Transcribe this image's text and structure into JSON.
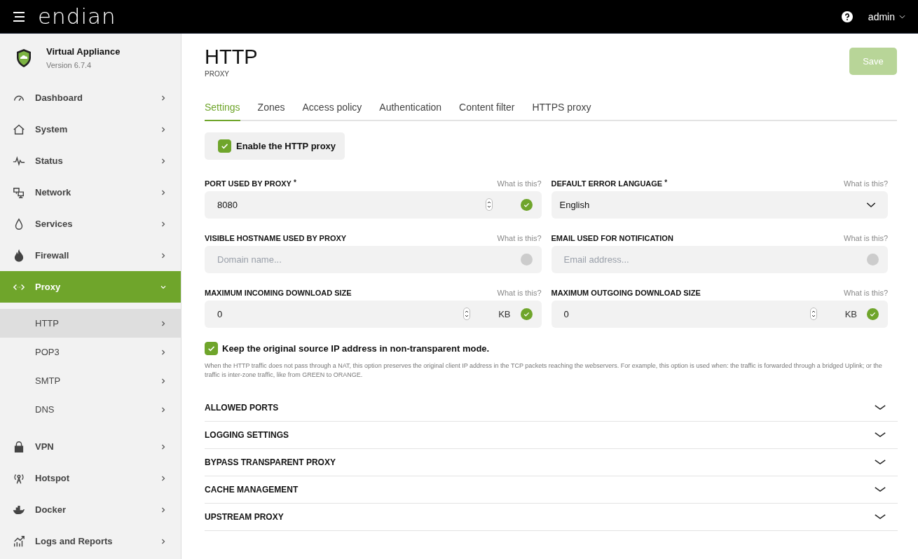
{
  "topbar": {
    "logo": "endian",
    "user": "admin"
  },
  "sidebar": {
    "product": "Virtual Appliance",
    "version": "Version 6.7.4",
    "items": [
      {
        "label": "Dashboard",
        "expanded": false,
        "selected": false
      },
      {
        "label": "System",
        "expanded": false,
        "selected": false
      },
      {
        "label": "Status",
        "expanded": false,
        "selected": false
      },
      {
        "label": "Network",
        "expanded": false,
        "selected": false
      },
      {
        "label": "Services",
        "expanded": false,
        "selected": false
      },
      {
        "label": "Firewall",
        "expanded": false,
        "selected": false
      },
      {
        "label": "Proxy",
        "expanded": true,
        "selected": true,
        "children": [
          {
            "label": "HTTP",
            "selected": true
          },
          {
            "label": "POP3",
            "selected": false
          },
          {
            "label": "SMTP",
            "selected": false
          },
          {
            "label": "DNS",
            "selected": false
          }
        ]
      },
      {
        "label": "VPN",
        "expanded": false,
        "selected": false
      },
      {
        "label": "Hotspot",
        "expanded": false,
        "selected": false
      },
      {
        "label": "Docker",
        "expanded": false,
        "selected": false
      },
      {
        "label": "Logs and Reports",
        "expanded": false,
        "selected": false
      }
    ]
  },
  "page": {
    "title": "HTTP",
    "subtitle": "PROXY",
    "save": {
      "label": "Save",
      "disabled": true
    }
  },
  "tabs": [
    {
      "label": "Settings",
      "selected": true
    },
    {
      "label": "Zones",
      "selected": false
    },
    {
      "label": "Access policy",
      "selected": false
    },
    {
      "label": "Authentication",
      "selected": false
    },
    {
      "label": "Content filter",
      "selected": false
    },
    {
      "label": "HTTPS proxy",
      "selected": false
    }
  ],
  "enable": {
    "label": "Enable the HTTP proxy",
    "checked": true
  },
  "fields": [
    {
      "kind": "number",
      "label": "PORT USED BY PROXY",
      "required_mark": "*",
      "help": "What is this?",
      "value": "8080",
      "valid": true
    },
    {
      "kind": "select",
      "label": "DEFAULT ERROR LANGUAGE",
      "required_mark": "*",
      "help": "What is this?",
      "value": "English"
    },
    {
      "kind": "text",
      "label": "VISIBLE HOSTNAME USED BY PROXY",
      "help": "What is this?",
      "placeholder": "Domain name...",
      "valid": false
    },
    {
      "kind": "text",
      "label": "EMAIL USED FOR NOTIFICATION",
      "help": "What is this?",
      "placeholder": "Email address...",
      "valid": false
    },
    {
      "kind": "number",
      "label": "MAXIMUM INCOMING DOWNLOAD SIZE",
      "help": "What is this?",
      "value": "0",
      "unit": "KB",
      "valid": true
    },
    {
      "kind": "number",
      "label": "MAXIMUM OUTGOING DOWNLOAD SIZE",
      "help": "What is this?",
      "value": "0",
      "unit": "KB",
      "valid": true
    }
  ],
  "keep_source_ip": {
    "label": "Keep the original source IP address in non-transparent mode.",
    "checked": true,
    "description": "When the HTTP traffic does not pass through a NAT, this option preserves the original client IP address in the TCP packets reaching the webservers. For example, this option is used when: the traffic is forwarded through a bridged Uplink; or the traffic is inter-zone traffic, like from GREEN to ORANGE."
  },
  "sections": [
    {
      "label": "ALLOWED PORTS",
      "expanded": false
    },
    {
      "label": "LOGGING SETTINGS",
      "expanded": false
    },
    {
      "label": "BYPASS TRANSPARENT PROXY",
      "expanded": false
    },
    {
      "label": "CACHE MANAGEMENT",
      "expanded": false
    },
    {
      "label": "UPSTREAM PROXY",
      "expanded": false
    }
  ]
}
